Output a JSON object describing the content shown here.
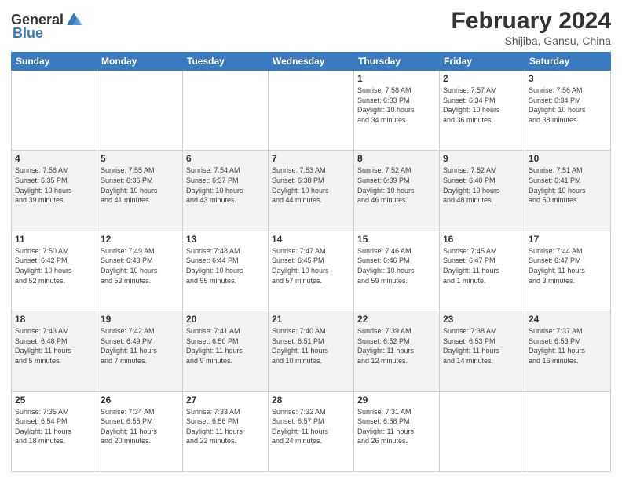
{
  "header": {
    "logo_general": "General",
    "logo_blue": "Blue",
    "title": "February 2024",
    "location": "Shijiba, Gansu, China"
  },
  "weekdays": [
    "Sunday",
    "Monday",
    "Tuesday",
    "Wednesday",
    "Thursday",
    "Friday",
    "Saturday"
  ],
  "weeks": [
    [
      {
        "day": "",
        "info": ""
      },
      {
        "day": "",
        "info": ""
      },
      {
        "day": "",
        "info": ""
      },
      {
        "day": "",
        "info": ""
      },
      {
        "day": "1",
        "info": "Sunrise: 7:58 AM\nSunset: 6:33 PM\nDaylight: 10 hours\nand 34 minutes."
      },
      {
        "day": "2",
        "info": "Sunrise: 7:57 AM\nSunset: 6:34 PM\nDaylight: 10 hours\nand 36 minutes."
      },
      {
        "day": "3",
        "info": "Sunrise: 7:56 AM\nSunset: 6:34 PM\nDaylight: 10 hours\nand 38 minutes."
      }
    ],
    [
      {
        "day": "4",
        "info": "Sunrise: 7:56 AM\nSunset: 6:35 PM\nDaylight: 10 hours\nand 39 minutes."
      },
      {
        "day": "5",
        "info": "Sunrise: 7:55 AM\nSunset: 6:36 PM\nDaylight: 10 hours\nand 41 minutes."
      },
      {
        "day": "6",
        "info": "Sunrise: 7:54 AM\nSunset: 6:37 PM\nDaylight: 10 hours\nand 43 minutes."
      },
      {
        "day": "7",
        "info": "Sunrise: 7:53 AM\nSunset: 6:38 PM\nDaylight: 10 hours\nand 44 minutes."
      },
      {
        "day": "8",
        "info": "Sunrise: 7:52 AM\nSunset: 6:39 PM\nDaylight: 10 hours\nand 46 minutes."
      },
      {
        "day": "9",
        "info": "Sunrise: 7:52 AM\nSunset: 6:40 PM\nDaylight: 10 hours\nand 48 minutes."
      },
      {
        "day": "10",
        "info": "Sunrise: 7:51 AM\nSunset: 6:41 PM\nDaylight: 10 hours\nand 50 minutes."
      }
    ],
    [
      {
        "day": "11",
        "info": "Sunrise: 7:50 AM\nSunset: 6:42 PM\nDaylight: 10 hours\nand 52 minutes."
      },
      {
        "day": "12",
        "info": "Sunrise: 7:49 AM\nSunset: 6:43 PM\nDaylight: 10 hours\nand 53 minutes."
      },
      {
        "day": "13",
        "info": "Sunrise: 7:48 AM\nSunset: 6:44 PM\nDaylight: 10 hours\nand 55 minutes."
      },
      {
        "day": "14",
        "info": "Sunrise: 7:47 AM\nSunset: 6:45 PM\nDaylight: 10 hours\nand 57 minutes."
      },
      {
        "day": "15",
        "info": "Sunrise: 7:46 AM\nSunset: 6:46 PM\nDaylight: 10 hours\nand 59 minutes."
      },
      {
        "day": "16",
        "info": "Sunrise: 7:45 AM\nSunset: 6:47 PM\nDaylight: 11 hours\nand 1 minute."
      },
      {
        "day": "17",
        "info": "Sunrise: 7:44 AM\nSunset: 6:47 PM\nDaylight: 11 hours\nand 3 minutes."
      }
    ],
    [
      {
        "day": "18",
        "info": "Sunrise: 7:43 AM\nSunset: 6:48 PM\nDaylight: 11 hours\nand 5 minutes."
      },
      {
        "day": "19",
        "info": "Sunrise: 7:42 AM\nSunset: 6:49 PM\nDaylight: 11 hours\nand 7 minutes."
      },
      {
        "day": "20",
        "info": "Sunrise: 7:41 AM\nSunset: 6:50 PM\nDaylight: 11 hours\nand 9 minutes."
      },
      {
        "day": "21",
        "info": "Sunrise: 7:40 AM\nSunset: 6:51 PM\nDaylight: 11 hours\nand 10 minutes."
      },
      {
        "day": "22",
        "info": "Sunrise: 7:39 AM\nSunset: 6:52 PM\nDaylight: 11 hours\nand 12 minutes."
      },
      {
        "day": "23",
        "info": "Sunrise: 7:38 AM\nSunset: 6:53 PM\nDaylight: 11 hours\nand 14 minutes."
      },
      {
        "day": "24",
        "info": "Sunrise: 7:37 AM\nSunset: 6:53 PM\nDaylight: 11 hours\nand 16 minutes."
      }
    ],
    [
      {
        "day": "25",
        "info": "Sunrise: 7:35 AM\nSunset: 6:54 PM\nDaylight: 11 hours\nand 18 minutes."
      },
      {
        "day": "26",
        "info": "Sunrise: 7:34 AM\nSunset: 6:55 PM\nDaylight: 11 hours\nand 20 minutes."
      },
      {
        "day": "27",
        "info": "Sunrise: 7:33 AM\nSunset: 6:56 PM\nDaylight: 11 hours\nand 22 minutes."
      },
      {
        "day": "28",
        "info": "Sunrise: 7:32 AM\nSunset: 6:57 PM\nDaylight: 11 hours\nand 24 minutes."
      },
      {
        "day": "29",
        "info": "Sunrise: 7:31 AM\nSunset: 6:58 PM\nDaylight: 11 hours\nand 26 minutes."
      },
      {
        "day": "",
        "info": ""
      },
      {
        "day": "",
        "info": ""
      }
    ]
  ]
}
